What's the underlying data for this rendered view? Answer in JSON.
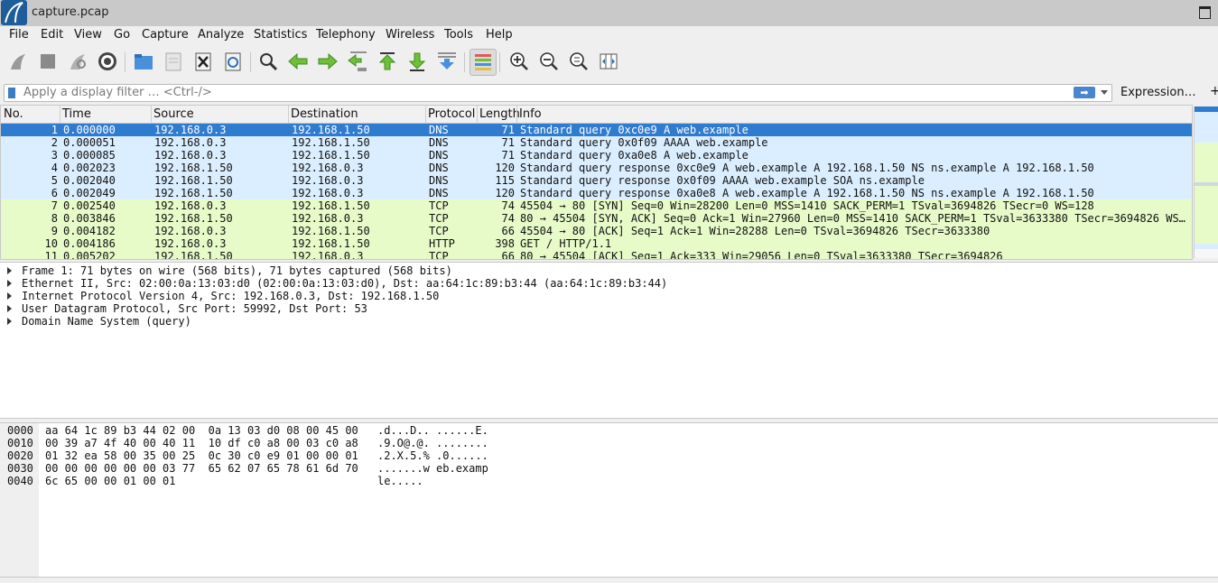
{
  "window": {
    "title": "capture.pcap"
  },
  "menu": [
    "File",
    "Edit",
    "View",
    "Go",
    "Capture",
    "Analyze",
    "Statistics",
    "Telephony",
    "Wireless",
    "Tools",
    "Help"
  ],
  "toolbar": {
    "icons": [
      "shark-fin-start-icon",
      "stop-icon",
      "restart-icon",
      "options-gear-icon",
      "open-folder-icon",
      "save-file-icon",
      "close-file-icon",
      "reload-icon",
      "find-icon",
      "go-back-icon",
      "go-forward-icon",
      "go-to-packet-icon",
      "go-first-icon",
      "go-last-icon",
      "autoscroll-icon",
      "colorize-icon",
      "zoom-in-icon",
      "zoom-out-icon",
      "zoom-normal-icon",
      "resize-columns-icon"
    ]
  },
  "filter": {
    "placeholder": "Apply a display filter … <Ctrl-/>",
    "expression_label": "Expression…",
    "plus_label": "+"
  },
  "packet_list": {
    "columns": [
      "No.",
      "Time",
      "Source",
      "Destination",
      "Protocol",
      "Length",
      "Info"
    ],
    "rows": [
      {
        "no": "1",
        "time": "0.000000",
        "src": "192.168.0.3",
        "dst": "192.168.1.50",
        "proto": "DNS",
        "len": "71",
        "info": "Standard query 0xc0e9 A web.example",
        "kind": "selected"
      },
      {
        "no": "2",
        "time": "0.000051",
        "src": "192.168.0.3",
        "dst": "192.168.1.50",
        "proto": "DNS",
        "len": "71",
        "info": "Standard query 0x0f09 AAAA web.example",
        "kind": "udp"
      },
      {
        "no": "3",
        "time": "0.000085",
        "src": "192.168.0.3",
        "dst": "192.168.1.50",
        "proto": "DNS",
        "len": "71",
        "info": "Standard query 0xa0e8 A web.example",
        "kind": "udp"
      },
      {
        "no": "4",
        "time": "0.002023",
        "src": "192.168.1.50",
        "dst": "192.168.0.3",
        "proto": "DNS",
        "len": "120",
        "info": "Standard query response 0xc0e9 A web.example A 192.168.1.50 NS ns.example A 192.168.1.50",
        "kind": "udp"
      },
      {
        "no": "5",
        "time": "0.002040",
        "src": "192.168.1.50",
        "dst": "192.168.0.3",
        "proto": "DNS",
        "len": "115",
        "info": "Standard query response 0x0f09 AAAA web.example SOA ns.example",
        "kind": "udp"
      },
      {
        "no": "6",
        "time": "0.002049",
        "src": "192.168.1.50",
        "dst": "192.168.0.3",
        "proto": "DNS",
        "len": "120",
        "info": "Standard query response 0xa0e8 A web.example A 192.168.1.50 NS ns.example A 192.168.1.50",
        "kind": "udp"
      },
      {
        "no": "7",
        "time": "0.002540",
        "src": "192.168.0.3",
        "dst": "192.168.1.50",
        "proto": "TCP",
        "len": "74",
        "info": "45504 → 80 [SYN] Seq=0 Win=28200 Len=0 MSS=1410 SACK_PERM=1 TSval=3694826 TSecr=0 WS=128",
        "kind": "tcp"
      },
      {
        "no": "8",
        "time": "0.003846",
        "src": "192.168.1.50",
        "dst": "192.168.0.3",
        "proto": "TCP",
        "len": "74",
        "info": "80 → 45504 [SYN, ACK] Seq=0 Ack=1 Win=27960 Len=0 MSS=1410 SACK_PERM=1 TSval=3633380 TSecr=3694826 WS…",
        "kind": "tcp"
      },
      {
        "no": "9",
        "time": "0.004182",
        "src": "192.168.0.3",
        "dst": "192.168.1.50",
        "proto": "TCP",
        "len": "66",
        "info": "45504 → 80 [ACK] Seq=1 Ack=1 Win=28288 Len=0 TSval=3694826 TSecr=3633380",
        "kind": "tcp"
      },
      {
        "no": "10",
        "time": "0.004186",
        "src": "192.168.0.3",
        "dst": "192.168.1.50",
        "proto": "HTTP",
        "len": "398",
        "info": "GET / HTTP/1.1",
        "kind": "tcp"
      },
      {
        "no": "11",
        "time": "0.005202",
        "src": "192.168.1.50",
        "dst": "192.168.0.3",
        "proto": "TCP",
        "len": "66",
        "info": "80 → 45504 [ACK] Seq=1 Ack=333 Win=29056 Len=0 TSval=3633380 TSecr=3694826",
        "kind": "tcp"
      }
    ]
  },
  "details": [
    "Frame 1: 71 bytes on wire (568 bits), 71 bytes captured (568 bits)",
    "Ethernet II, Src: 02:00:0a:13:03:d0 (02:00:0a:13:03:d0), Dst: aa:64:1c:89:b3:44 (aa:64:1c:89:b3:44)",
    "Internet Protocol Version 4, Src: 192.168.0.3, Dst: 192.168.1.50",
    "User Datagram Protocol, Src Port: 59992, Dst Port: 53",
    "Domain Name System (query)"
  ],
  "bytes": [
    {
      "offset": "0000",
      "hex": "aa 64 1c 89 b3 44 02 00  0a 13 03 d0 08 00 45 00",
      "ascii": ".d...D.. ......E."
    },
    {
      "offset": "0010",
      "hex": "00 39 a7 4f 40 00 40 11  10 df c0 a8 00 03 c0 a8",
      "ascii": ".9.O@.@. ........"
    },
    {
      "offset": "0020",
      "hex": "01 32 ea 58 00 35 00 25  0c 30 c0 e9 01 00 00 01",
      "ascii": ".2.X.5.% .0......"
    },
    {
      "offset": "0030",
      "hex": "00 00 00 00 00 00 03 77  65 62 07 65 78 61 6d 70",
      "ascii": ".......w eb.examp"
    },
    {
      "offset": "0040",
      "hex": "6c 65 00 00 01 00 01",
      "ascii": "le....."
    }
  ],
  "colors": {
    "selected_bg": "#2e7bcf",
    "udp_bg": "#daeeff",
    "tcp_bg": "#e7fbc8",
    "accent": "#3b7dc5"
  }
}
